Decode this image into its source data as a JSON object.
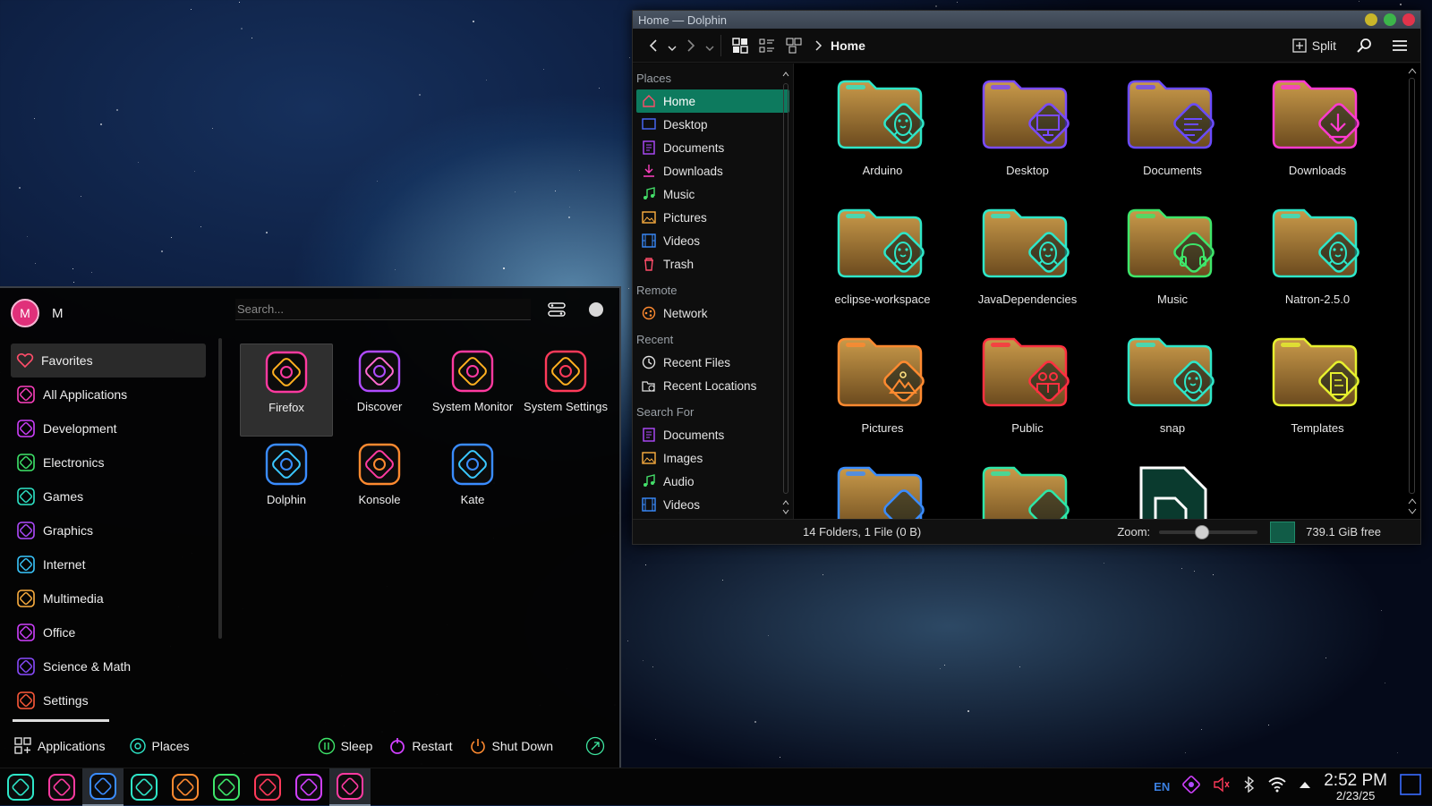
{
  "wallpaper": "starfield",
  "dolphin": {
    "title": "Home — Dolphin",
    "breadcrumb": "Home",
    "split_label": "Split",
    "places_sections": [
      {
        "header": "Places",
        "items": [
          {
            "label": "Home",
            "icon": "home-icon",
            "color": "#ff4d6a",
            "active": true
          },
          {
            "label": "Desktop",
            "icon": "desktop-icon",
            "color": "#4b6bff"
          },
          {
            "label": "Documents",
            "icon": "documents-icon",
            "color": "#b04bff"
          },
          {
            "label": "Downloads",
            "icon": "downloads-icon",
            "color": "#ff40c0"
          },
          {
            "label": "Music",
            "icon": "music-icon",
            "color": "#44e06a"
          },
          {
            "label": "Pictures",
            "icon": "pictures-icon",
            "color": "#ffb040"
          },
          {
            "label": "Videos",
            "icon": "videos-icon",
            "color": "#3a8cff"
          },
          {
            "label": "Trash",
            "icon": "trash-icon",
            "color": "#ff4d6a"
          }
        ]
      },
      {
        "header": "Remote",
        "items": [
          {
            "label": "Network",
            "icon": "network-icon",
            "color": "#ff8a30"
          }
        ]
      },
      {
        "header": "Recent",
        "items": [
          {
            "label": "Recent Files",
            "icon": "clock-icon",
            "color": "#e0e0e0"
          },
          {
            "label": "Recent Locations",
            "icon": "folder-clock-icon",
            "color": "#e0e0e0"
          }
        ]
      },
      {
        "header": "Search For",
        "items": [
          {
            "label": "Documents",
            "icon": "documents-icon",
            "color": "#b04bff"
          },
          {
            "label": "Images",
            "icon": "pictures-icon",
            "color": "#ffb040"
          },
          {
            "label": "Audio",
            "icon": "music-icon",
            "color": "#44e06a"
          },
          {
            "label": "Videos",
            "icon": "videos-icon",
            "color": "#3a8cff"
          }
        ]
      }
    ],
    "files": [
      {
        "name": "Arduino",
        "color": "#2ee6c8",
        "emblem": "penguin"
      },
      {
        "name": "Desktop",
        "color": "#7a4bff",
        "emblem": "monitor"
      },
      {
        "name": "Documents",
        "color": "#6a4bff",
        "emblem": "lines"
      },
      {
        "name": "Downloads",
        "color": "#ff3ad0",
        "emblem": "download"
      },
      {
        "name": "eclipse-workspace",
        "color": "#2ee6c8",
        "emblem": "penguin"
      },
      {
        "name": "JavaDependencies",
        "color": "#2ee6c8",
        "emblem": "penguin"
      },
      {
        "name": "Music",
        "color": "#3ee66a",
        "emblem": "headphones"
      },
      {
        "name": "Natron-2.5.0",
        "color": "#2ee6c8",
        "emblem": "penguin"
      },
      {
        "name": "Pictures",
        "color": "#ff8a30",
        "emblem": "mountain"
      },
      {
        "name": "Public",
        "color": "#ff3040",
        "emblem": "people"
      },
      {
        "name": "snap",
        "color": "#2ee6c8",
        "emblem": "penguin"
      },
      {
        "name": "Templates",
        "color": "#e6f02e",
        "emblem": "template"
      },
      {
        "name": "",
        "color": "#3a8cff",
        "emblem": "partial"
      },
      {
        "name": "",
        "color": "#2ee6a8",
        "emblem": "partial"
      },
      {
        "name": "",
        "color": "#2ee6c8",
        "emblem": "file"
      }
    ],
    "status_text": "14 Folders, 1 File (0 B)",
    "zoom_label": "Zoom:",
    "zoom_level": 0.42,
    "free_space": "739.1 GiB free"
  },
  "launcher": {
    "user_initial": "M",
    "user_name": "M",
    "search_placeholder": "Search...",
    "categories": [
      {
        "label": "Favorites",
        "color": "#ff4d6a",
        "active": true
      },
      {
        "label": "All Applications",
        "color": "#ff40c0"
      },
      {
        "label": "Development",
        "color": "#d040ff"
      },
      {
        "label": "Electronics",
        "color": "#3ee66a"
      },
      {
        "label": "Games",
        "color": "#2ee6c8"
      },
      {
        "label": "Graphics",
        "color": "#b04bff"
      },
      {
        "label": "Internet",
        "color": "#3ac8ff"
      },
      {
        "label": "Multimedia",
        "color": "#ffb040"
      },
      {
        "label": "Office",
        "color": "#d040ff"
      },
      {
        "label": "Science & Math",
        "color": "#8a4bff"
      },
      {
        "label": "Settings",
        "color": "#ff5a3a"
      }
    ],
    "apps": [
      {
        "label": "Firefox",
        "color": "#ff3aa0",
        "accent": "#ffb020",
        "active": true
      },
      {
        "label": "Discover",
        "color": "#b04bff",
        "accent": "#ff6ad0"
      },
      {
        "label": "System Monitor",
        "color": "#ff3aa0",
        "accent": "#ffb020"
      },
      {
        "label": "System Settings",
        "color": "#ff3a5a",
        "accent": "#ffb020"
      },
      {
        "label": "Dolphin",
        "color": "#3a8cff",
        "accent": "#3ac8ff"
      },
      {
        "label": "Konsole",
        "color": "#ff8a30",
        "accent": "#ff3aa0"
      },
      {
        "label": "Kate",
        "color": "#3a8cff",
        "accent": "#3ac8ff"
      }
    ],
    "footer": {
      "applications_label": "Applications",
      "places_label": "Places",
      "sleep_label": "Sleep",
      "restart_label": "Restart",
      "shutdown_label": "Shut Down"
    }
  },
  "taskbar": {
    "items": [
      {
        "name": "launcher",
        "color": "#2ee6c8"
      },
      {
        "name": "firefox",
        "color": "#ff3aa0"
      },
      {
        "name": "dolphin",
        "color": "#3a8cff",
        "open": true
      },
      {
        "name": "kate",
        "color": "#2ee6c8"
      },
      {
        "name": "konsole",
        "color": "#ff8a30"
      },
      {
        "name": "terminal",
        "color": "#3ee66a"
      },
      {
        "name": "settings",
        "color": "#ff3a5a"
      },
      {
        "name": "games",
        "color": "#d040ff"
      },
      {
        "name": "screenshot",
        "color": "#ff3aa0",
        "open": true
      }
    ],
    "lang": "EN",
    "time": "2:52 PM",
    "date": "2/23/25"
  }
}
